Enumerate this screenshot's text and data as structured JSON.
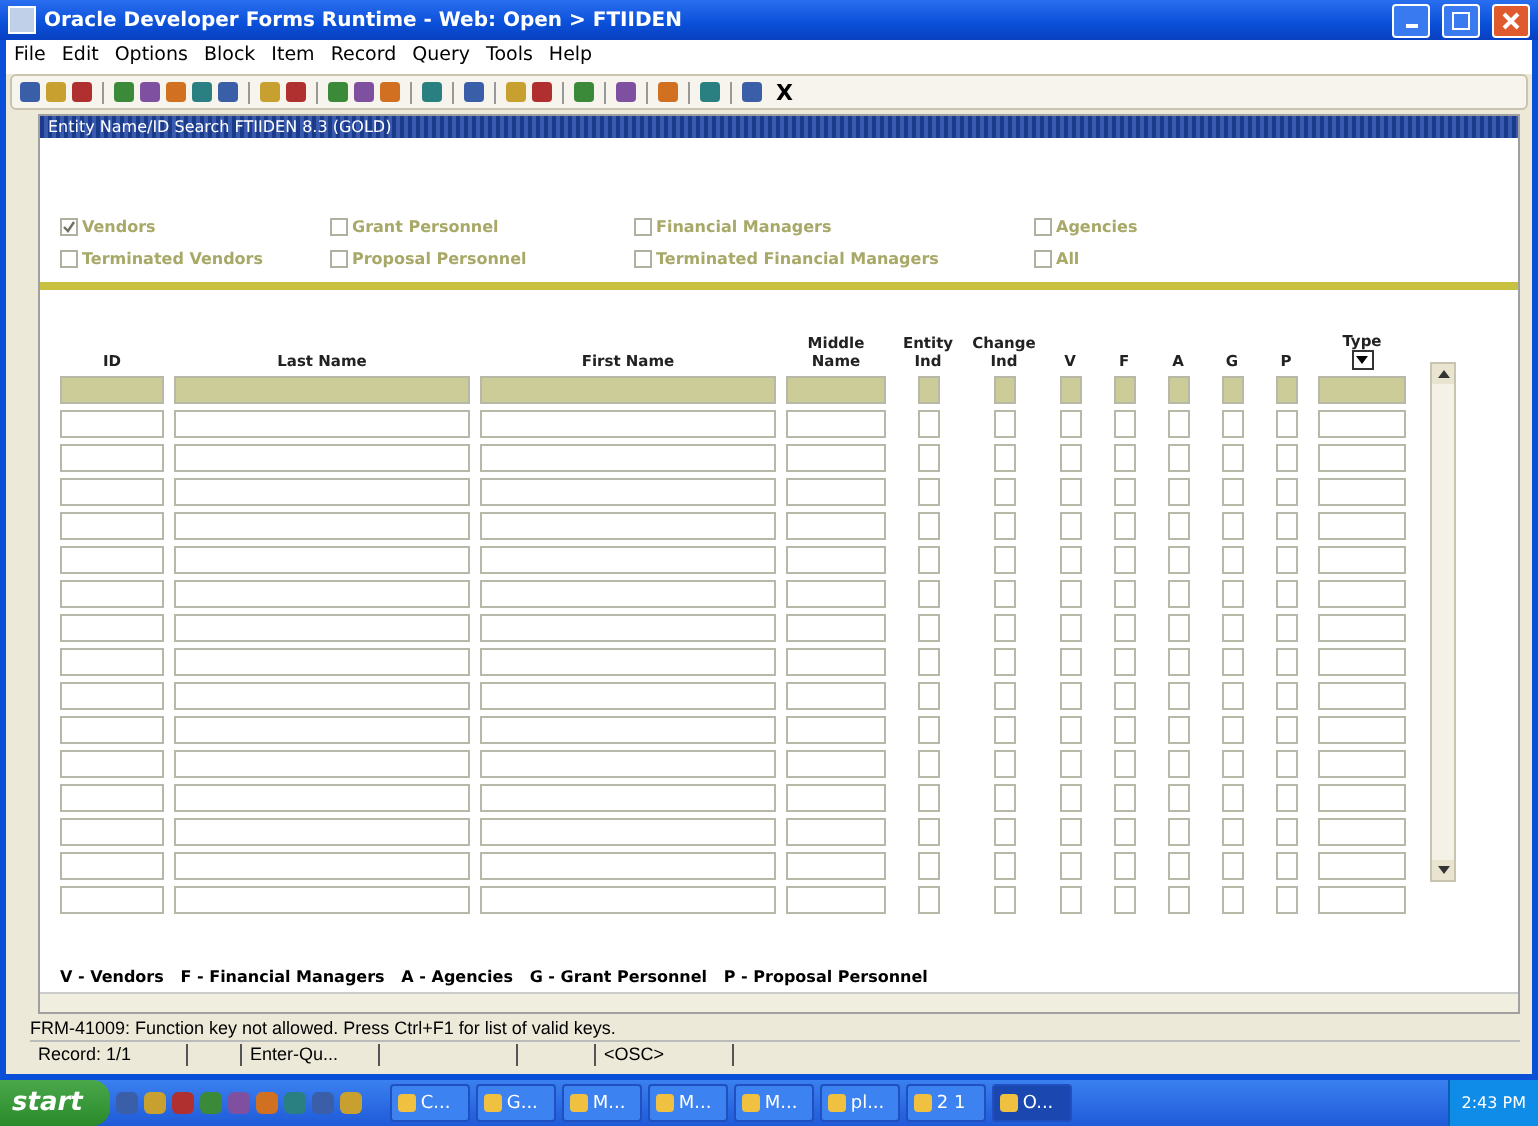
{
  "window": {
    "title": "Oracle Developer Forms Runtime - Web:  Open > FTIIDEN"
  },
  "menu": [
    "File",
    "Edit",
    "Options",
    "Block",
    "Item",
    "Record",
    "Query",
    "Tools",
    "Help"
  ],
  "toolbar": {
    "exit_label": "X"
  },
  "form": {
    "title": "Entity Name/ID Search  FTIIDEN  8.3  (GOLD)",
    "filters": [
      {
        "label": "Vendors",
        "checked": true
      },
      {
        "label": "Terminated Vendors",
        "checked": false
      },
      {
        "label": "Grant Personnel",
        "checked": false
      },
      {
        "label": "Proposal Personnel",
        "checked": false
      },
      {
        "label": "Financial Managers",
        "checked": false
      },
      {
        "label": "Terminated Financial Managers",
        "checked": false
      },
      {
        "label": "Agencies",
        "checked": false
      },
      {
        "label": "All",
        "checked": false
      }
    ],
    "columns": [
      {
        "label": "ID",
        "kind": "text"
      },
      {
        "label": "Last Name",
        "kind": "text"
      },
      {
        "label": "First Name",
        "kind": "text"
      },
      {
        "label": "Middle Name",
        "kind": "text"
      },
      {
        "label": "Entity Ind",
        "kind": "flag"
      },
      {
        "label": "Change Ind",
        "kind": "flag"
      },
      {
        "label": "V",
        "kind": "flag"
      },
      {
        "label": "F",
        "kind": "flag"
      },
      {
        "label": "A",
        "kind": "flag"
      },
      {
        "label": "G",
        "kind": "flag"
      },
      {
        "label": "P",
        "kind": "flag"
      },
      {
        "label": "Type",
        "kind": "list"
      }
    ],
    "records": [
      {
        "selected": true
      },
      {
        "selected": false
      },
      {
        "selected": false
      },
      {
        "selected": false
      },
      {
        "selected": false
      },
      {
        "selected": false
      },
      {
        "selected": false
      },
      {
        "selected": false
      },
      {
        "selected": false
      },
      {
        "selected": false
      },
      {
        "selected": false
      },
      {
        "selected": false
      },
      {
        "selected": false
      },
      {
        "selected": false
      },
      {
        "selected": false
      },
      {
        "selected": false
      }
    ],
    "legend": "V - Vendors   F - Financial Managers   A - Agencies   G - Grant Personnel   P - Proposal Personnel"
  },
  "status_bar": {
    "message": "FRM-41009: Function key not allowed.  Press Ctrl+F1 for list of valid keys.",
    "fields": [
      "Record: 1/1",
      "Enter-Qu...",
      "<OSC>"
    ]
  },
  "taskbar": {
    "start": "start",
    "tasks": [
      {
        "label": "C...",
        "selected": false
      },
      {
        "label": "G...",
        "selected": false
      },
      {
        "label": "M...",
        "selected": false
      },
      {
        "label": "M...",
        "selected": false
      },
      {
        "label": "M...",
        "selected": false
      },
      {
        "label": "pl...",
        "selected": false
      },
      {
        "label": "2 1",
        "selected": false
      },
      {
        "label": "O...",
        "selected": true
      }
    ],
    "clock": "2:43 PM"
  }
}
